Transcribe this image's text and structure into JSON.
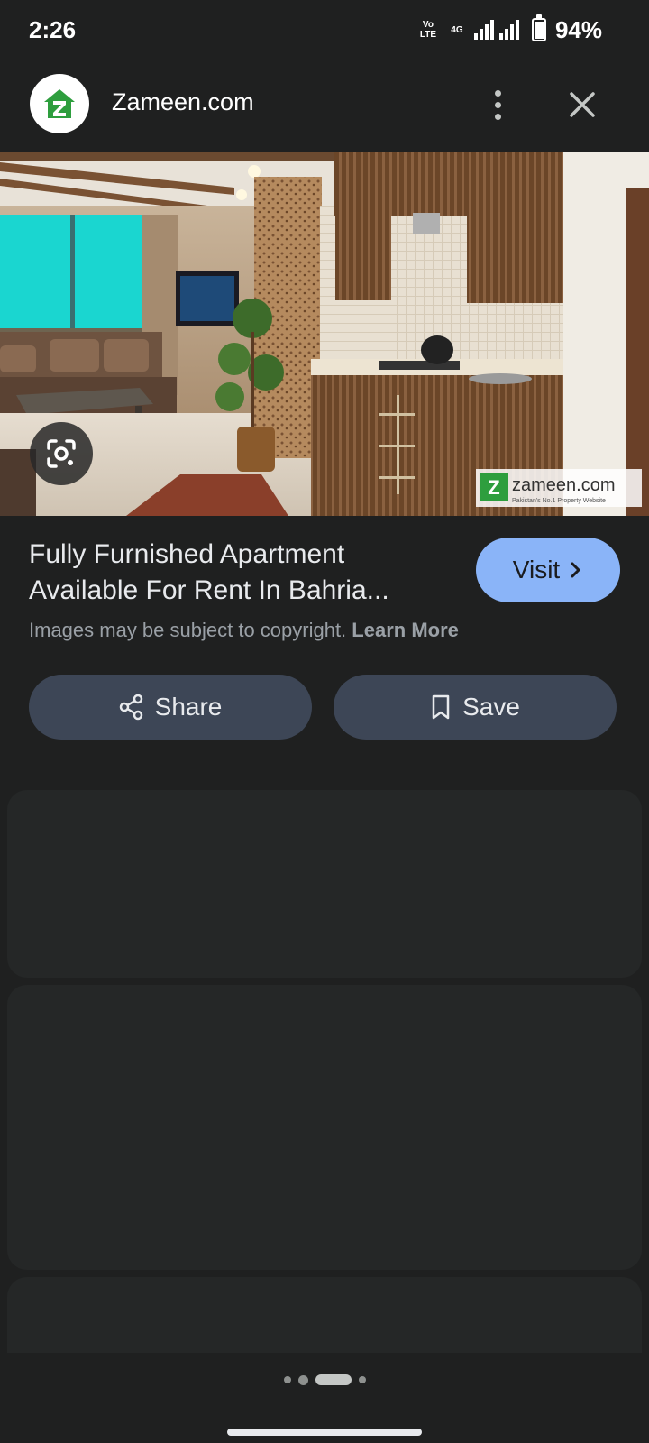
{
  "status_bar": {
    "time": "2:26",
    "network_tag_top": "Vo LTE",
    "network_tag_bottom": "4G",
    "battery": "94%"
  },
  "header": {
    "site_name": "Zameen.com",
    "logo_icon": "zameen-house-logo",
    "menu_icon": "more-vert-icon",
    "close_icon": "close-icon"
  },
  "image": {
    "watermark": "zameen.com",
    "watermark_sub": "Pakistan's No.1 Property Website",
    "lens_icon": "google-lens-icon"
  },
  "result": {
    "title_line1": "Fully Furnished Apartment",
    "title_line2": "Available For Rent In Bahria...",
    "visit_label": "Visit",
    "copyright_text": "Images may be subject to copyright.",
    "learn_more": "Learn More"
  },
  "actions": {
    "share_label": "Share",
    "save_label": "Save"
  },
  "colors": {
    "background": "#1f2020",
    "accent": "#8ab4f8",
    "button_bg": "#3d4656",
    "card_bg": "#252727"
  }
}
